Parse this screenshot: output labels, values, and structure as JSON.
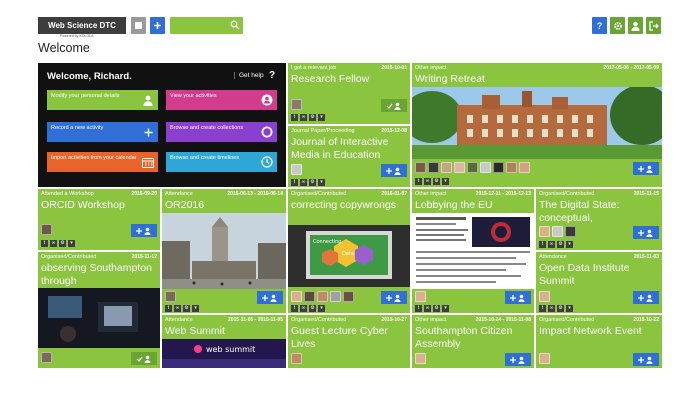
{
  "header": {
    "brand": "Web Science DTC",
    "powered_by": "Powered by KOLOLA",
    "search_placeholder": "",
    "page_title": "Welcome"
  },
  "intro": {
    "greeting": "Welcome, Richard.",
    "get_help": "Get help",
    "help_glyph": "?",
    "buttons": [
      {
        "label": "Modify your personal details",
        "color": "#8bc53f",
        "icon": "person-icon"
      },
      {
        "label": "View your activities",
        "color": "#d23c8c",
        "icon": "person-circle-icon"
      },
      {
        "label": "Record a new activity",
        "color": "#2f6fd6",
        "icon": "plus-icon"
      },
      {
        "label": "Browse and create collections",
        "color": "#8a3fcf",
        "icon": "circle-icon"
      },
      {
        "label": "Import activities from your calendar",
        "color": "#e8642a",
        "icon": "calendar-icon"
      },
      {
        "label": "Browse and create timelines",
        "color": "#2fa7d6",
        "icon": "clock-icon"
      }
    ]
  },
  "tiles": [
    {
      "category": "I got a relevant job",
      "date": "2015-10-01",
      "title": "Research Fellow"
    },
    {
      "category": "Journal Paper/Proceeding",
      "date": "2015-12-08",
      "title": "Journal of Interactive Media in Education"
    },
    {
      "category": "Other impact",
      "date": "2017-05-06 - 2017-05-09",
      "title": "Writing Retreat"
    },
    {
      "category": "Attended a Workshop",
      "date": "2016-09-20",
      "title": "ORCID Workshop"
    },
    {
      "category": "Attendance",
      "date": "2016-06-13 - 2016-06-14",
      "title": "OR2016"
    },
    {
      "category": "Organised/Contributed",
      "date": "2016-01-07",
      "title": "correcting copywrongs"
    },
    {
      "category": "Other impact",
      "date": "2015-12-11 - 2015-12-13",
      "title": "Lobbying the EU"
    },
    {
      "category": "Organised/Contributed",
      "date": "2015-11-15",
      "title": "The Digital State: conceptual,"
    },
    {
      "category": "Organised/Contributed",
      "date": "2015-11-12",
      "title": "observing Southampton through"
    },
    {
      "category": "Attendance",
      "date": "2015-11-03",
      "title": "Open Data Institute Summit"
    },
    {
      "category": "Attendance",
      "date": "2015-11-05 - 2015-11-05",
      "title": "Web Summit"
    },
    {
      "category": "Organised/Contributed",
      "date": "2015-10-27",
      "title": "Guest Lecture Cyber Lives"
    },
    {
      "category": "Other impact",
      "date": "2015-10-24 - 2015-11-08",
      "title": "Southampton Citizen Assembly"
    },
    {
      "category": "Organised/Contributed",
      "date": "2015-10-22",
      "title": "Impact Network Event"
    }
  ],
  "poster_label_1": "Connecting",
  "poster_label_2": "Data",
  "websummit_label": "web summit",
  "colors": {
    "tile_green": "#8bc53f",
    "dark_green": "#6aa533",
    "follow_blue": "#2f6fd6",
    "header_dark": "#3d3d3d"
  }
}
